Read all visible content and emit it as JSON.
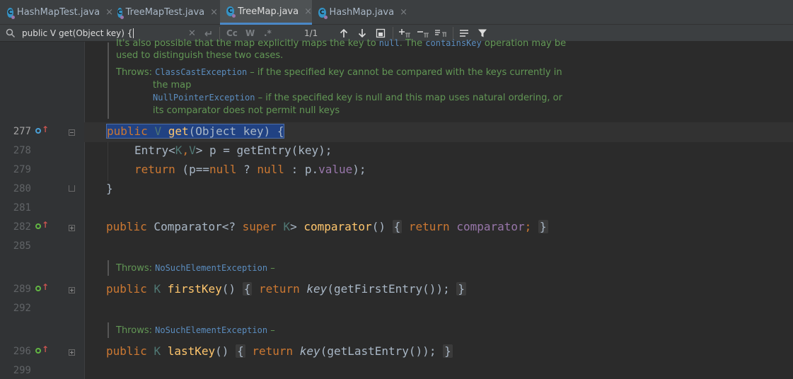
{
  "tabs": [
    {
      "label": "HashMapTest.java",
      "active": false
    },
    {
      "label": "TreeMapTest.java",
      "active": false
    },
    {
      "label": "TreeMap.java",
      "active": true
    },
    {
      "label": "HashMap.java",
      "active": false
    }
  ],
  "tab_close": "×",
  "tab_icon_letter": "C",
  "search": {
    "value": "public V get(Object key) {",
    "match_case": "Cc",
    "words": "W",
    "regex": ".*",
    "count": "1/1"
  },
  "doc_top": {
    "line1_pre": "It's also possible that the map explicitly maps the key to ",
    "line1_code": "null",
    "line1_mid": ". The ",
    "line1_code2": "containsKey",
    "line1_post": " operation may be",
    "line2": "used to distinguish these two cases.",
    "throws_label": "Throws: ",
    "ex1": "ClassCastException",
    "ex1_desc": " – if the specified key cannot be compared with the keys currently in",
    "ex1_desc2": "the map",
    "ex2": "NullPointerException",
    "ex2_desc": " – if the specified key is null and this map uses natural ordering, or",
    "ex2_desc2": "its comparator does not permit null keys"
  },
  "line_numbers": [
    "277",
    "278",
    "279",
    "280",
    "281",
    "282",
    "285",
    "289",
    "292",
    "296",
    "299"
  ],
  "code": {
    "l277_public": "public",
    "l277_V": "V",
    "l277_get": "get",
    "l277_rest": "(Object key) {",
    "l278_a": "Entry<",
    "l278_K": "K",
    "l278_comma": ",",
    "l278_V": "V",
    "l278_b": "> p = ",
    "l278_fn": "getEntry",
    "l278_c": "(key);",
    "l279_return": "return",
    "l279_a": " (p==",
    "l279_null1": "null",
    "l279_b": " ? ",
    "l279_null2": "null",
    "l279_c": " : p.",
    "l279_value": "value",
    "l279_d": ");",
    "l280": "}",
    "l282_public": "public",
    "l282_a": " Comparator<? ",
    "l282_super": "super",
    "l282_K": " K",
    "l282_b": "> ",
    "l282_fn": "comparator",
    "l282_paren": "()",
    "l282_ob": "{",
    "l282_return": "return",
    "l282_field": "comparator",
    "l282_semi": ";",
    "l282_cb": "}",
    "l289_public": "public",
    "l289_K": "K",
    "l289_fn": "firstKey",
    "l289_paren": "()",
    "l289_ob": "{",
    "l289_return": "return",
    "l289_key": "key",
    "l289_rest": "(getFirstEntry());",
    "l289_cb": "}",
    "l296_public": "public",
    "l296_K": "K",
    "l296_fn": "lastKey",
    "l296_paren": "()",
    "l296_ob": "{",
    "l296_return": "return",
    "l296_key": "key",
    "l296_rest": "(getLastEntry());",
    "l296_cb": "}"
  },
  "doc_first": {
    "throws": "Throws: ",
    "ex": "NoSuchElementException",
    "dash": " –"
  },
  "doc_last": {
    "throws": "Throws: ",
    "ex": "NoSuchElementException",
    "dash": " –"
  },
  "colors": {
    "keyword": "#cc7832",
    "function": "#ffc66d",
    "type_param": "#507874",
    "field": "#9876aa",
    "doc": "#629755",
    "doc_code": "#5b8dbf",
    "selection": "#214283"
  }
}
